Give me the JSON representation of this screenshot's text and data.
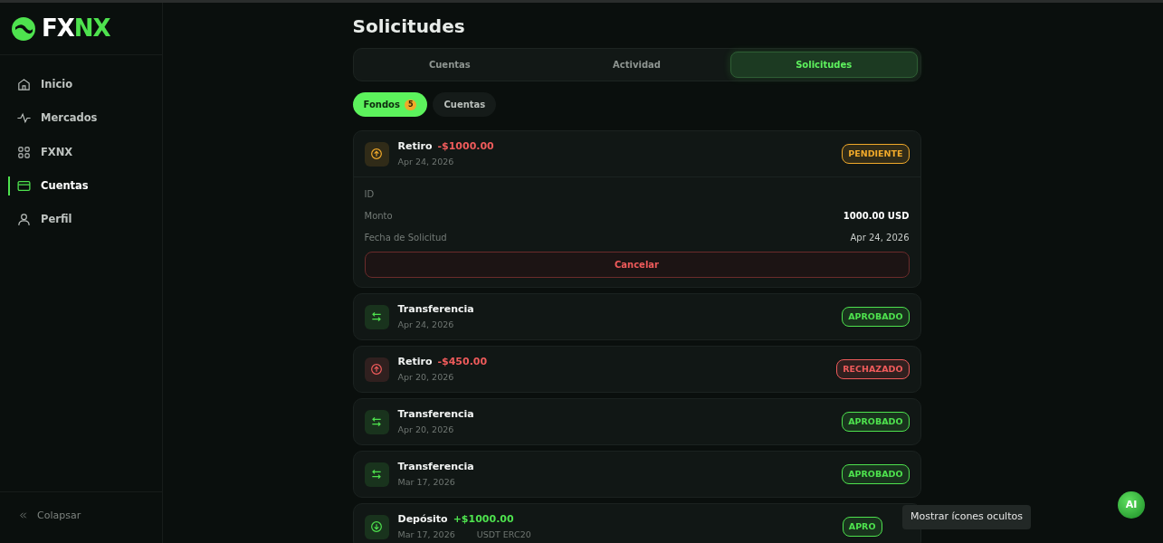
{
  "logo": {
    "text_main": "FX",
    "text_accent": "NX"
  },
  "sidebar": {
    "items": [
      {
        "label": "Inicio",
        "selected": false
      },
      {
        "label": "Mercados",
        "selected": false
      },
      {
        "label": "FXNX",
        "selected": false
      },
      {
        "label": "Cuentas",
        "selected": true
      },
      {
        "label": "Perfil",
        "selected": false
      }
    ],
    "collapse": "Colapsar"
  },
  "page_title": "Solicitudes",
  "tabs": [
    {
      "label": "Cuentas",
      "selected": false
    },
    {
      "label": "Actividad",
      "selected": false
    },
    {
      "label": "Solicitudes",
      "selected": true
    }
  ],
  "filters": [
    {
      "label": "Fondos",
      "count": "5",
      "selected": true
    },
    {
      "label": "Cuentas",
      "selected": false
    }
  ],
  "requests": [
    {
      "kind": "withdraw",
      "title": "Retiro",
      "amount": "-$1000.00",
      "date": "Apr 24, 2026",
      "status": "PENDIENTE",
      "color": "#f0a92a",
      "details": [
        {
          "label": "ID"
        },
        {
          "label": "Monto",
          "value": "1000.00 USD"
        },
        {
          "label": "Fecha de Solicitud",
          "value": "Apr 24, 2026"
        }
      ],
      "action": "Cancelar"
    },
    {
      "kind": "transfer",
      "title": "Transferencia",
      "date": "Apr 24, 2026",
      "status": "APROBADO",
      "color": "#4ee24e"
    },
    {
      "kind": "withdraw",
      "title": "Retiro",
      "amount": "-$450.00",
      "date": "Apr 20, 2026",
      "status": "RECHAZADO",
      "color": "#ef5b5b"
    },
    {
      "kind": "transfer",
      "title": "Transferencia",
      "date": "Apr 20, 2026",
      "status": "APROBADO",
      "color": "#4ee24e"
    },
    {
      "kind": "transfer",
      "title": "Transferencia",
      "date": "Mar 17, 2026",
      "status": "APROBADO",
      "color": "#4ee24e"
    },
    {
      "kind": "deposit",
      "title": "Depósito",
      "amount": "+$1000.00",
      "date": "Mar 17, 2026",
      "network": "USDT ERC20",
      "status": "APRO",
      "color": "#4ee24e"
    }
  ],
  "tooltip": "Mostrar ícones ocultos",
  "ai_button": "AI"
}
